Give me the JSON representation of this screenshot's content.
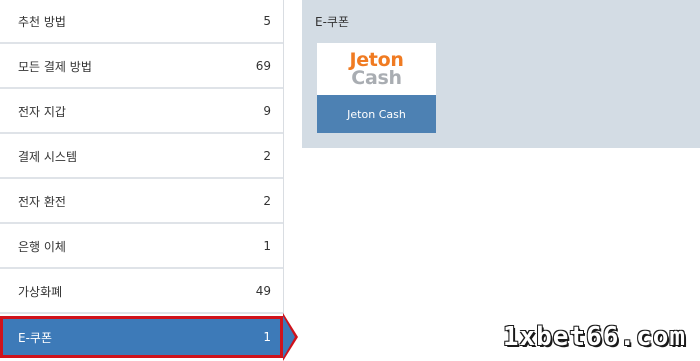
{
  "sidebar": {
    "items": [
      {
        "label": "추천 방법",
        "count": "5"
      },
      {
        "label": "모든 결제 방법",
        "count": "69"
      },
      {
        "label": "전자 지갑",
        "count": "9"
      },
      {
        "label": "결제 시스템",
        "count": "2"
      },
      {
        "label": "전자 환전",
        "count": "2"
      },
      {
        "label": "은행 이체",
        "count": "1"
      },
      {
        "label": "가상화폐",
        "count": "49"
      },
      {
        "label": "E-쿠폰",
        "count": "1"
      }
    ]
  },
  "panel": {
    "title": "E-쿠폰",
    "cards": [
      {
        "logo_line1": "Jeton",
        "logo_line2": "Cash",
        "label": "Jeton Cash"
      }
    ]
  },
  "watermark": "1xbet66.com",
  "colors": {
    "active_bg": "#3d7ab8",
    "highlight_border": "#d0121b",
    "panel_bg": "#d3dce4",
    "jeton_orange": "#f07b22",
    "card_label_bg": "#4d81b3"
  }
}
